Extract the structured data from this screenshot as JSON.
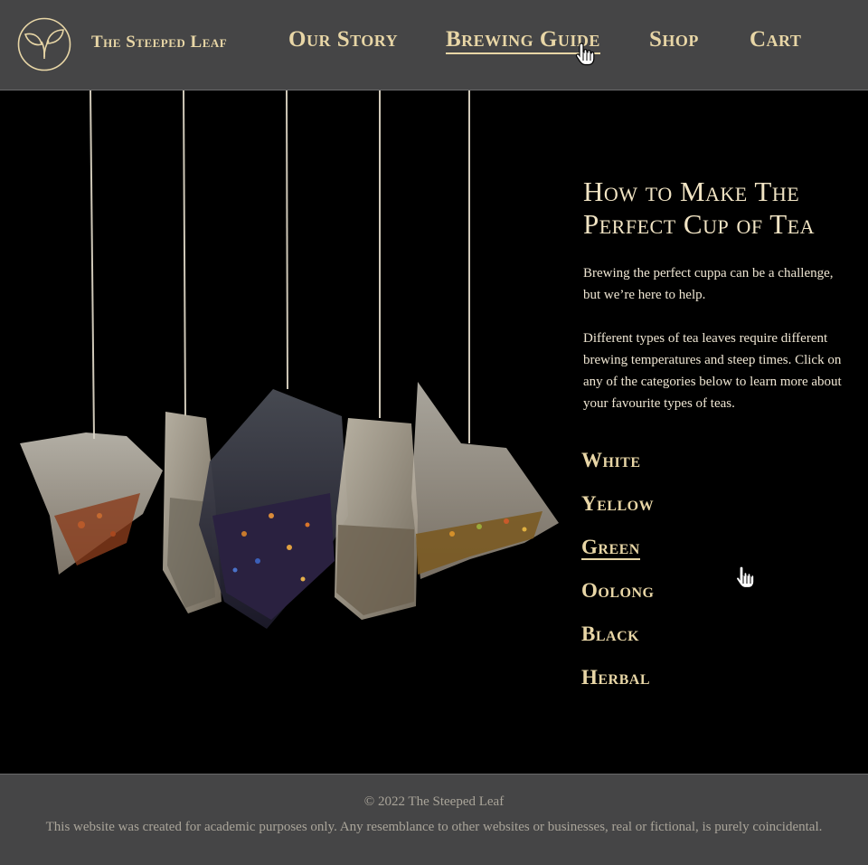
{
  "header": {
    "brand": "The Steeped Leaf",
    "logo_icon": "leaf-logo-icon",
    "nav": [
      {
        "label": "Our Story",
        "active": false
      },
      {
        "label": "Brewing Guide",
        "active": true
      },
      {
        "label": "Shop",
        "active": false
      },
      {
        "label": "Cart",
        "active": false
      }
    ]
  },
  "main": {
    "title_line1": "How to Make The",
    "title_line2": "Perfect Cup of Tea",
    "paragraph1": "Brewing the perfect cuppa can be a challenge, but we’re here to help.",
    "paragraph2": "Different types of tea leaves require different brewing temperatures and steep times. Click on any of the categories below to learn more about your favourite types of teas.",
    "categories": [
      {
        "label": "White",
        "active": false
      },
      {
        "label": "Yellow",
        "active": false
      },
      {
        "label": "Green",
        "active": true
      },
      {
        "label": "Oolong",
        "active": false
      },
      {
        "label": "Black",
        "active": false
      },
      {
        "label": "Herbal",
        "active": false
      }
    ],
    "hero_image": "hanging-tea-bags"
  },
  "footer": {
    "copyright": "© 2022 The Steeped Leaf",
    "disclaimer": "This website was created for academic purposes only. Any resemblance to other websites or businesses, real or fictional, is purely coincidental."
  },
  "colors": {
    "header_bg": "#454546",
    "accent_gold": "#e8d6a6",
    "footer_text": "#a9a499",
    "page_bg": "#000000"
  }
}
